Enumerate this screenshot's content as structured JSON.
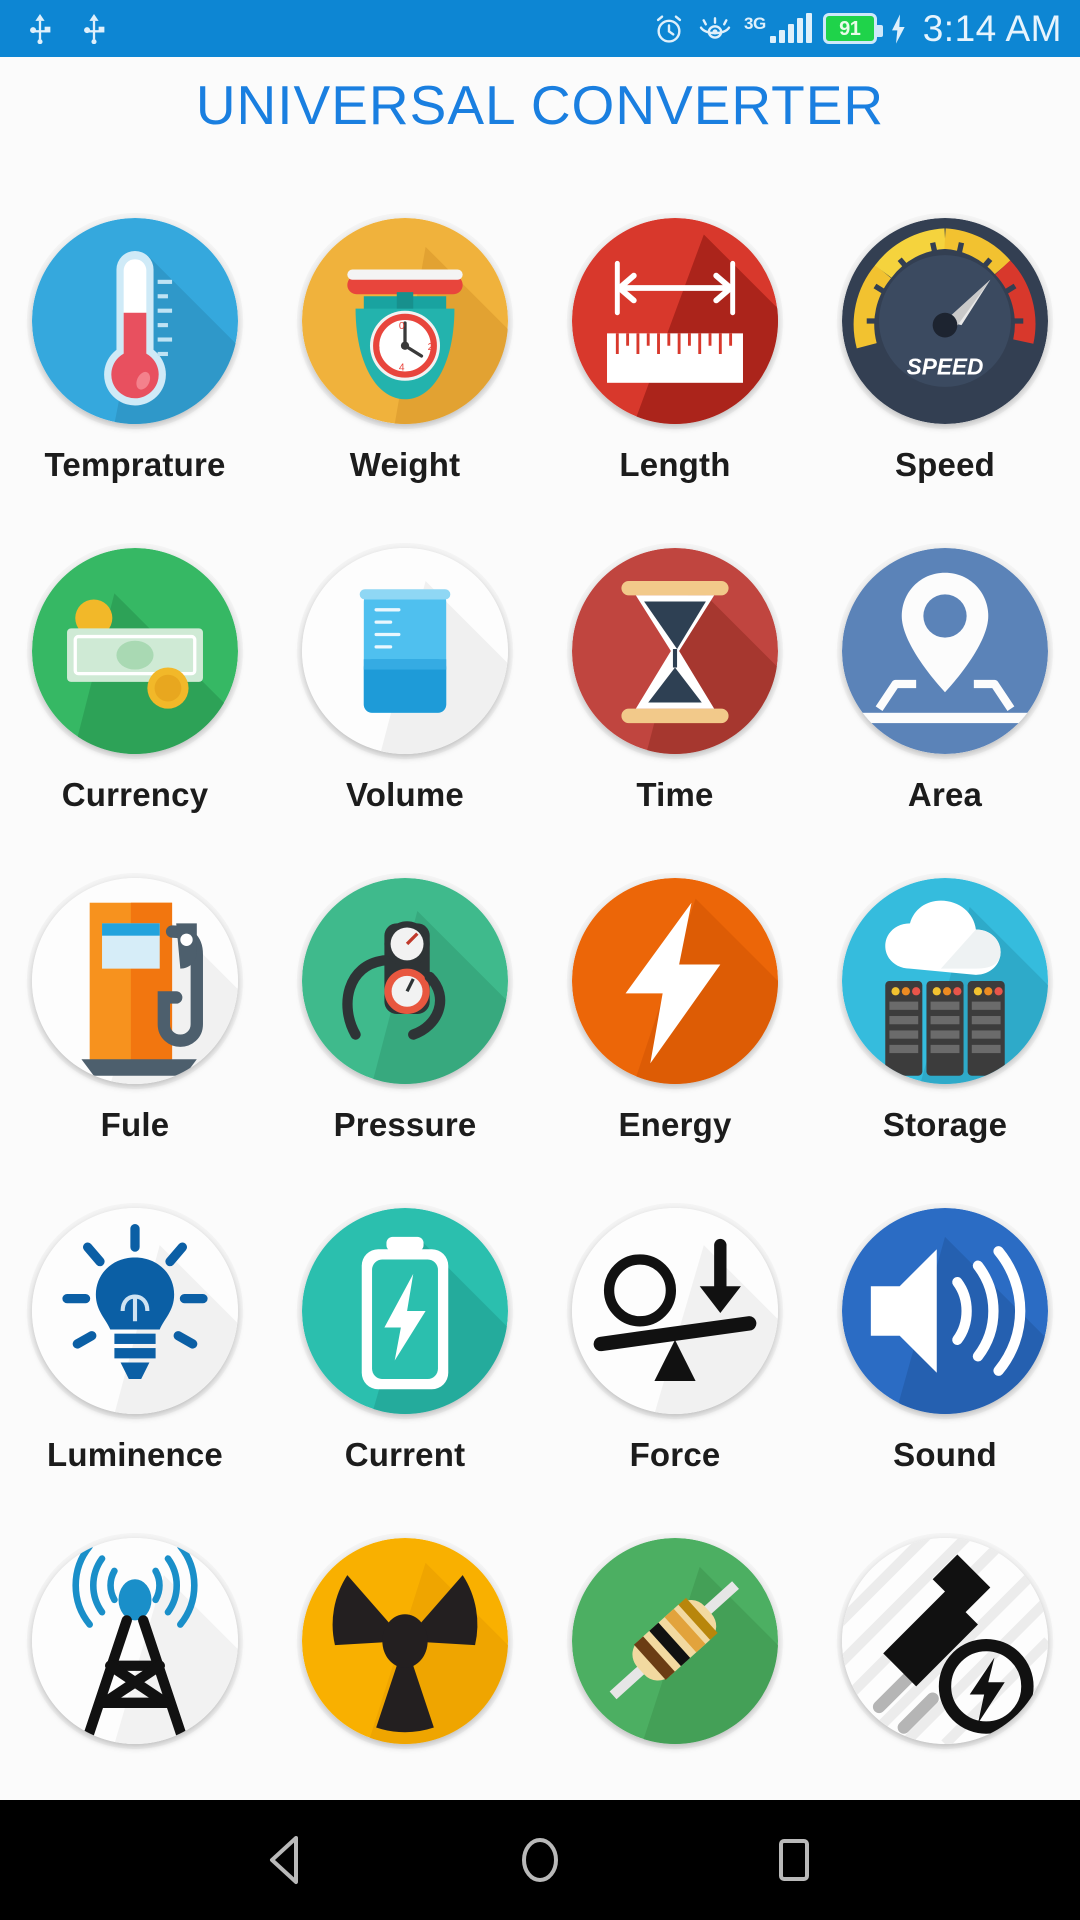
{
  "status_bar": {
    "background": "#0d86d3",
    "left_icons": [
      "usb-icon",
      "usb-icon"
    ],
    "alarm_icon": "alarm-clock-icon",
    "eye_icon": "eye-icon",
    "network_type": "3G",
    "signal_icon": "signal-bars-icon",
    "battery_level": "91",
    "battery_color": "#1fd34a",
    "charging_icon": "charging-bolt-icon",
    "time": "3:14 AM"
  },
  "header": {
    "title": "UNIVERSAL CONVERTER",
    "title_color": "#1a7fe0"
  },
  "grid": {
    "items": [
      {
        "label": "Temprature",
        "icon": "thermometer-icon",
        "bg": "#35a8dd"
      },
      {
        "label": "Weight",
        "icon": "kitchen-scale-icon",
        "bg": "#f0b23c"
      },
      {
        "label": "Length",
        "icon": "ruler-arrow-icon",
        "bg": "#b7271f"
      },
      {
        "label": "Speed",
        "icon": "speedometer-icon",
        "bg": "#333f52"
      },
      {
        "label": "Currency",
        "icon": "banknote-icon",
        "bg": "#36b864"
      },
      {
        "label": "Volume",
        "icon": "beaker-icon",
        "bg": "#ffffff"
      },
      {
        "label": "Time",
        "icon": "hourglass-icon",
        "bg": "#c0453f"
      },
      {
        "label": "Area",
        "icon": "map-pin-icon",
        "bg": "#5b83b8"
      },
      {
        "label": "Fule",
        "icon": "fuel-pump-icon",
        "bg": "#ffffff"
      },
      {
        "label": "Pressure",
        "icon": "pressure-gauge-icon",
        "bg": "#3fba8c"
      },
      {
        "label": "Energy",
        "icon": "lightning-bolt-icon",
        "bg": "#ec6608"
      },
      {
        "label": "Storage",
        "icon": "cloud-server-icon",
        "bg": "#35bcdd"
      },
      {
        "label": "Luminence",
        "icon": "light-bulb-icon",
        "bg": "#ffffff"
      },
      {
        "label": "Current",
        "icon": "battery-bolt-icon",
        "bg": "#2bbfae"
      },
      {
        "label": "Force",
        "icon": "lever-force-icon",
        "bg": "#ffffff"
      },
      {
        "label": "Sound",
        "icon": "speaker-waves-icon",
        "bg": "#2b6cc4"
      },
      {
        "label": "",
        "icon": "radio-tower-icon",
        "bg": "#ffffff"
      },
      {
        "label": "",
        "icon": "radiation-icon",
        "bg": "#f9b000"
      },
      {
        "label": "",
        "icon": "resistor-icon",
        "bg": "#4caf62"
      },
      {
        "label": "",
        "icon": "power-plug-icon",
        "bg": "#ffffff"
      }
    ]
  },
  "nav_bar": {
    "back": "back-triangle-icon",
    "home": "home-circle-icon",
    "recents": "recents-square-icon"
  }
}
